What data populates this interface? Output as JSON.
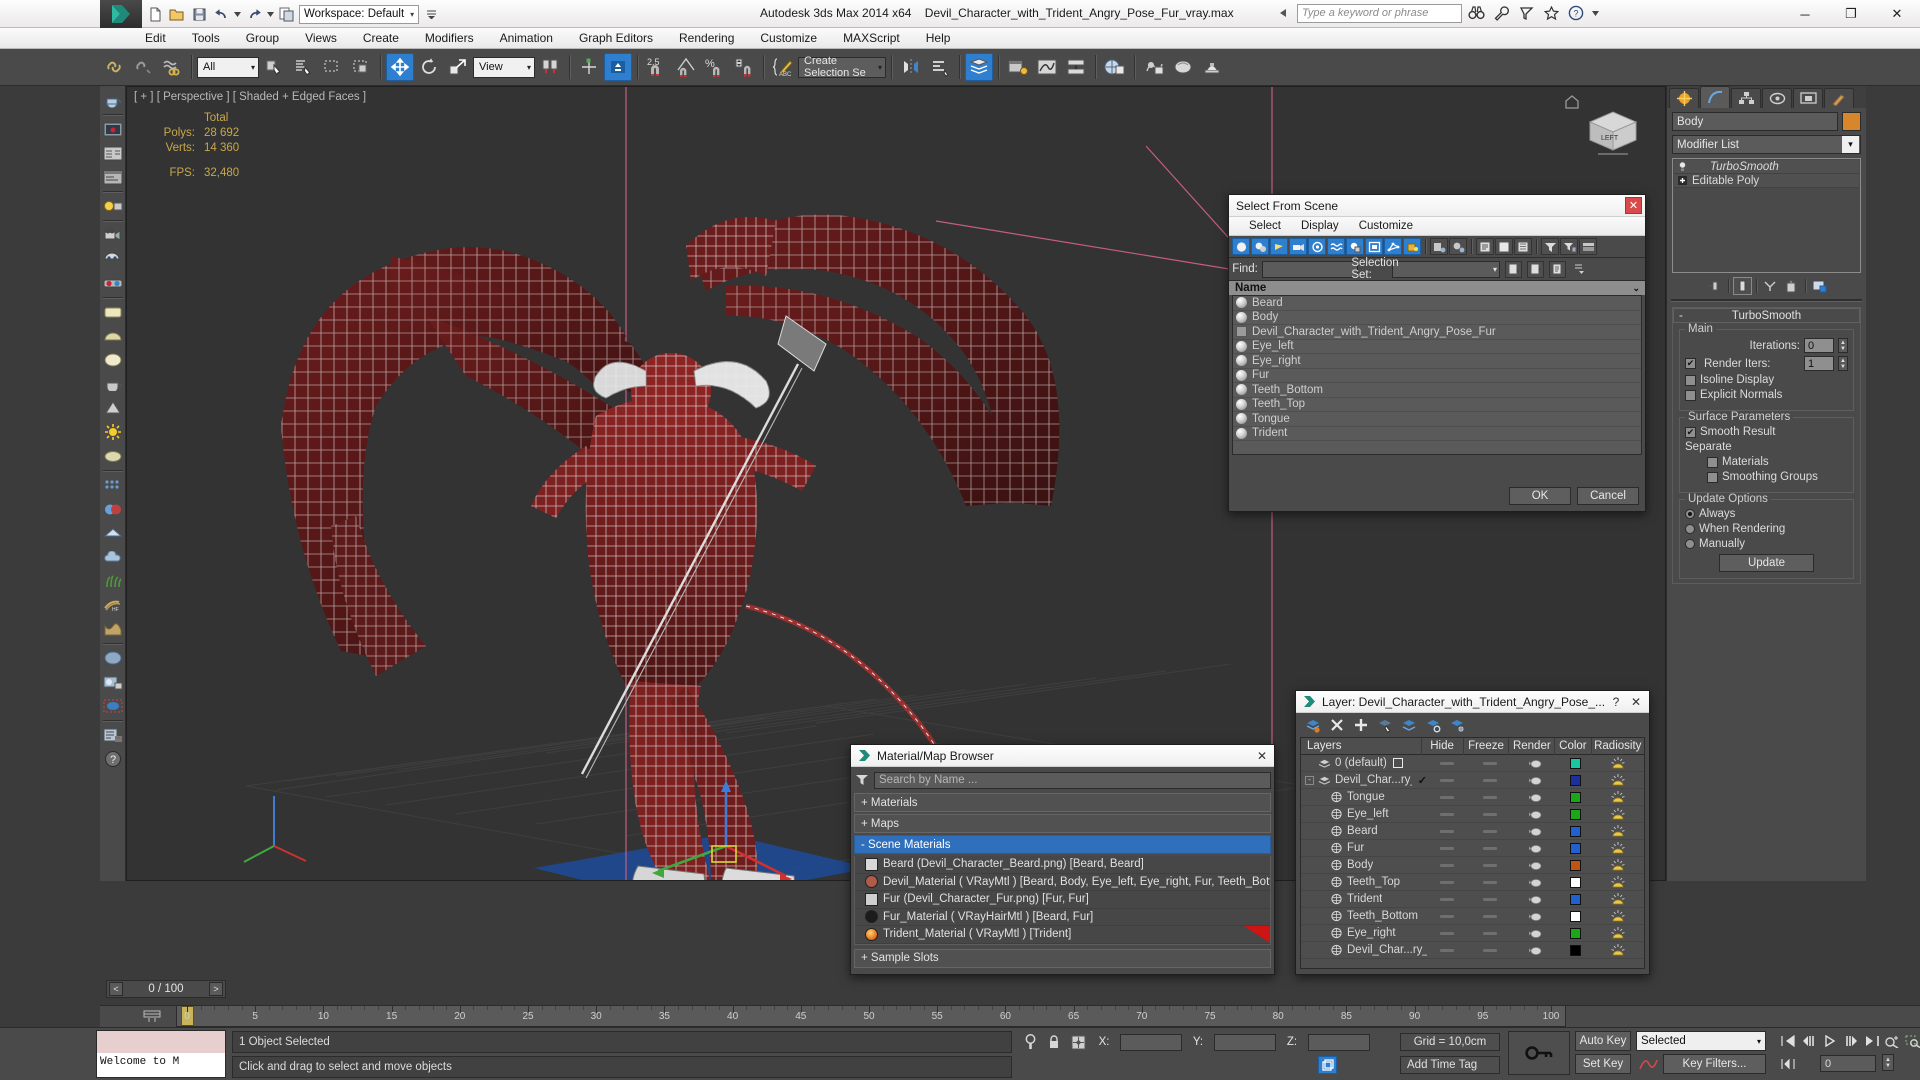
{
  "app": {
    "title_product": "Autodesk 3ds Max  2014 x64",
    "title_file": "Devil_Character_with_Trident_Angry_Pose_Fur_vray.max",
    "workspace_label": "Workspace: Default",
    "search_placeholder": "Type a keyword or phrase",
    "window_buttons": {
      "minimize": "─",
      "restore": "❐",
      "close": "✕"
    }
  },
  "menu": {
    "items": [
      "Edit",
      "Tools",
      "Group",
      "Views",
      "Create",
      "Modifiers",
      "Animation",
      "Graph Editors",
      "Rendering",
      "Customize",
      "MAXScript",
      "Help"
    ]
  },
  "toolbar": {
    "selection_filter": "All",
    "reference_coord": "View",
    "named_selection_set": "Create Selection Se",
    "angle_snap_value": "2.5",
    "percent_label": "%"
  },
  "viewport": {
    "label": "[ + ] [ Perspective ] [ Shaded + Edged Faces ]",
    "stats_header": "Total",
    "stats": [
      {
        "label": "Polys:",
        "value": "28 692"
      },
      {
        "label": "Verts:",
        "value": "14 360"
      }
    ],
    "fps_label": "FPS:",
    "fps_value": "32,480",
    "cube_label": "LEFT"
  },
  "command_panel": {
    "object_name": "Body",
    "object_color": "#d8862c",
    "modifier_list_label": "Modifier List",
    "stack": [
      {
        "label": "TurboSmooth",
        "italic": true
      },
      {
        "label": "Editable Poly",
        "italic": false
      }
    ],
    "rollup_title": "TurboSmooth",
    "groups": {
      "main": {
        "label": "Main",
        "iterations_label": "Iterations:",
        "iterations_value": "0",
        "render_iters_label": "Render Iters:",
        "render_iters_value": "1",
        "render_iters_checked": true,
        "isoline_label": "Isoline Display",
        "isoline_checked": false,
        "explicit_normals_label": "Explicit Normals",
        "explicit_normals_checked": false
      },
      "surface": {
        "label": "Surface Parameters",
        "smooth_result_label": "Smooth Result",
        "smooth_result_checked": true,
        "separate_label": "Separate",
        "materials_label": "Materials",
        "materials_checked": false,
        "smoothing_groups_label": "Smoothing Groups",
        "smoothing_groups_checked": false
      },
      "update": {
        "label": "Update Options",
        "options": [
          "Always",
          "When Rendering",
          "Manually"
        ],
        "selected": "Always",
        "button": "Update"
      }
    }
  },
  "select_from_scene": {
    "title": "Select From Scene",
    "menu": [
      "Select",
      "Display",
      "Customize"
    ],
    "find_label": "Find:",
    "find_value": "",
    "selection_set_label": "Selection Set:",
    "selection_set_value": "",
    "column_header": "Name",
    "rows": [
      {
        "name": "Beard",
        "icon": "sphere-icon"
      },
      {
        "name": "Body",
        "icon": "sphere-icon"
      },
      {
        "name": "Devil_Character_with_Trident_Angry_Pose_Fur",
        "icon": "group-icon"
      },
      {
        "name": "Eye_left",
        "icon": "sphere-icon"
      },
      {
        "name": "Eye_right",
        "icon": "sphere-icon"
      },
      {
        "name": "Fur",
        "icon": "sphere-icon"
      },
      {
        "name": "Teeth_Bottom",
        "icon": "sphere-icon"
      },
      {
        "name": "Teeth_Top",
        "icon": "sphere-icon"
      },
      {
        "name": "Tongue",
        "icon": "sphere-icon"
      },
      {
        "name": "Trident",
        "icon": "sphere-icon"
      }
    ],
    "ok": "OK",
    "cancel": "Cancel"
  },
  "material_browser": {
    "title": "Material/Map Browser",
    "search_placeholder": "Search by Name ...",
    "groups": [
      {
        "label": "+ Materials",
        "selected": false
      },
      {
        "label": "+ Maps",
        "selected": false
      },
      {
        "label": "-  Scene Materials",
        "selected": true
      }
    ],
    "scene_materials": [
      {
        "label": "Beard (Devil_Character_Beard.png)  [Beard, Beard]",
        "swatch": "#d8d8d8",
        "active": false
      },
      {
        "label": "Devil_Material  ( VRayMtl )  [Beard, Body, Eye_left, Eye_right, Fur, Teeth_Bottom...",
        "swatch": "#b05a4a",
        "active": false
      },
      {
        "label": "Fur (Devil_Character_Fur.png)  [Fur, Fur]",
        "swatch": "#cfcfcf",
        "active": false
      },
      {
        "label": "Fur_Material  ( VRayHairMtl )  [Beard, Fur]",
        "swatch": "#222222",
        "active": false
      },
      {
        "label": "Trident_Material  ( VRayMtl )  [Trident]",
        "swatch": "#e06a1e",
        "active": true
      }
    ],
    "footer_group": "+ Sample Slots"
  },
  "layer_manager": {
    "title": "Layer: Devil_Character_with_Trident_Angry_Pose_...",
    "help_glyph": "?",
    "close_glyph": "✕",
    "columns": [
      "Layers",
      "Hide",
      "Freeze",
      "Render",
      "Color",
      "Radiosity"
    ],
    "rows": [
      {
        "name": "0 (default)",
        "indent": 0,
        "type": "layer",
        "color": "#18c8a0",
        "checkbox": "empty",
        "expander": ""
      },
      {
        "name": "Devil_Char...ry_Pos",
        "indent": 0,
        "type": "layer",
        "color": "#1c2f9c",
        "checkbox": "check",
        "expander": "minus"
      },
      {
        "name": "Tongue",
        "indent": 1,
        "type": "object",
        "color": "#1aa81a",
        "checkbox": "",
        "expander": ""
      },
      {
        "name": "Eye_left",
        "indent": 1,
        "type": "object",
        "color": "#1aa81a",
        "checkbox": "",
        "expander": ""
      },
      {
        "name": "Beard",
        "indent": 1,
        "type": "object",
        "color": "#2060d0",
        "checkbox": "",
        "expander": ""
      },
      {
        "name": "Fur",
        "indent": 1,
        "type": "object",
        "color": "#2060d0",
        "checkbox": "",
        "expander": ""
      },
      {
        "name": "Body",
        "indent": 1,
        "type": "object",
        "color": "#c05410",
        "checkbox": "",
        "expander": ""
      },
      {
        "name": "Teeth_Top",
        "indent": 1,
        "type": "object",
        "color": "#ffffff",
        "checkbox": "",
        "expander": ""
      },
      {
        "name": "Trident",
        "indent": 1,
        "type": "object",
        "color": "#2060d0",
        "checkbox": "",
        "expander": ""
      },
      {
        "name": "Teeth_Bottom",
        "indent": 1,
        "type": "object",
        "color": "#ffffff",
        "checkbox": "",
        "expander": ""
      },
      {
        "name": "Eye_right",
        "indent": 1,
        "type": "object",
        "color": "#1aa81a",
        "checkbox": "",
        "expander": ""
      },
      {
        "name": "Devil_Char...ry_",
        "indent": 1,
        "type": "object",
        "color": "#000000",
        "checkbox": "",
        "expander": ""
      }
    ]
  },
  "timeline": {
    "frame_indicator": "0 / 100",
    "prev_glyph": "<",
    "next_glyph": ">",
    "ticks": [
      0,
      5,
      10,
      15,
      20,
      25,
      30,
      35,
      40,
      45,
      50,
      55,
      60,
      65,
      70,
      75,
      80,
      85,
      90,
      95,
      100
    ],
    "current_frame": 0
  },
  "status": {
    "listener_text": "Welcome to M",
    "selection_status": "1 Object Selected",
    "prompt": "Click and drag to select and move objects",
    "x_label": "X:",
    "x_value": "",
    "y_label": "Y:",
    "y_value": "",
    "z_label": "Z:",
    "z_value": "",
    "grid": "Grid = 10,0cm",
    "add_time_tag": "Add Time Tag",
    "auto_key": "Auto Key",
    "set_key": "Set Key",
    "selection_mode": "Selected",
    "key_filters": "Key Filters...",
    "current_frame_field": "0"
  }
}
